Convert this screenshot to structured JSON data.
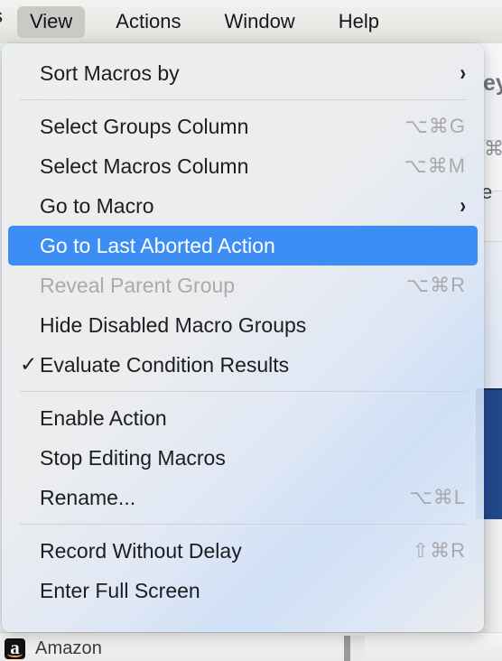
{
  "menubar": {
    "clipped_left_glyph": "s",
    "items": [
      {
        "label": "View",
        "active": true
      },
      {
        "label": "Actions",
        "active": false
      },
      {
        "label": "Window",
        "active": false
      },
      {
        "label": "Help",
        "active": false
      }
    ]
  },
  "view_menu": {
    "groups": [
      {
        "items": [
          {
            "label": "Sort Macros by",
            "shortcut": "",
            "submenu": true,
            "checked": false,
            "disabled": false,
            "highlighted": false
          }
        ]
      },
      {
        "items": [
          {
            "label": "Select Groups Column",
            "shortcut": "⌥⌘G",
            "submenu": false,
            "checked": false,
            "disabled": false,
            "highlighted": false
          },
          {
            "label": "Select Macros Column",
            "shortcut": "⌥⌘M",
            "submenu": false,
            "checked": false,
            "disabled": false,
            "highlighted": false
          },
          {
            "label": "Go to Macro",
            "shortcut": "",
            "submenu": true,
            "checked": false,
            "disabled": false,
            "highlighted": false
          },
          {
            "label": "Go to Last Aborted Action",
            "shortcut": "",
            "submenu": false,
            "checked": false,
            "disabled": false,
            "highlighted": true
          },
          {
            "label": "Reveal Parent Group",
            "shortcut": "⌥⌘R",
            "submenu": false,
            "checked": false,
            "disabled": true,
            "highlighted": false
          },
          {
            "label": "Hide Disabled Macro Groups",
            "shortcut": "",
            "submenu": false,
            "checked": false,
            "disabled": false,
            "highlighted": false
          },
          {
            "label": "Evaluate Condition Results",
            "shortcut": "",
            "submenu": false,
            "checked": true,
            "disabled": false,
            "highlighted": false
          }
        ]
      },
      {
        "items": [
          {
            "label": "Enable Action",
            "shortcut": "",
            "submenu": false,
            "checked": false,
            "disabled": false,
            "highlighted": false
          },
          {
            "label": "Stop Editing Macros",
            "shortcut": "",
            "submenu": false,
            "checked": false,
            "disabled": false,
            "highlighted": false
          },
          {
            "label": "Rename...",
            "shortcut": "⌥⌘L",
            "submenu": false,
            "checked": false,
            "disabled": false,
            "highlighted": false
          }
        ]
      },
      {
        "items": [
          {
            "label": "Record Without Delay",
            "shortcut": "⇧⌘R",
            "submenu": false,
            "checked": false,
            "disabled": false,
            "highlighted": false
          },
          {
            "label": "Enter Full Screen",
            "shortcut": "",
            "submenu": false,
            "checked": false,
            "disabled": false,
            "highlighted": false
          }
        ]
      }
    ],
    "checkmark_glyph": "✓",
    "submenu_glyph": "›"
  },
  "background": {
    "clipped_texts": [
      {
        "text": "ey"
      },
      {
        "text": "⌘"
      },
      {
        "text": "e"
      }
    ]
  },
  "bottom_list": {
    "row": {
      "label": "Amazon",
      "icon_letter": "a"
    }
  },
  "colors": {
    "highlight_blue": "#3d8ef4",
    "menu_background": "#edeeee",
    "text_primary": "#1b1d20",
    "text_disabled": "#aaaaab",
    "shortcut_gray": "#a9a9ab",
    "selected_row_blue": "#22488c",
    "amazon_orange": "#f19b3d"
  }
}
